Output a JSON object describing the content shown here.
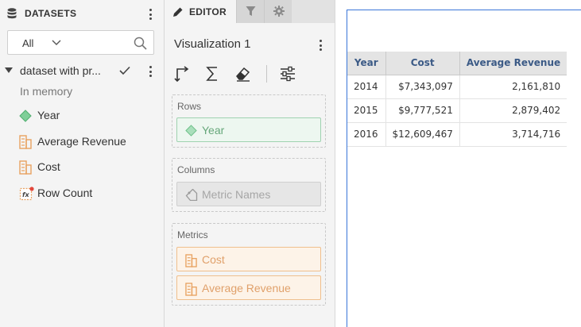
{
  "datasets_panel": {
    "title": "DATASETS",
    "filter": {
      "selected": "All"
    },
    "dataset": {
      "name": "dataset with pr...",
      "status": "In memory"
    },
    "objects": [
      {
        "label": "Year",
        "icon": "attribute-icon"
      },
      {
        "label": "Average Revenue",
        "icon": "metric-icon"
      },
      {
        "label": "Cost",
        "icon": "metric-icon"
      },
      {
        "label": "Row Count",
        "icon": "derived-metric-icon"
      }
    ]
  },
  "editor_panel": {
    "tabs": {
      "editor": "EDITOR",
      "filter_icon": "filter-icon",
      "settings_icon": "gear-icon"
    },
    "visualization_title": "Visualization 1",
    "toolbar": [
      "swap-axes-icon",
      "sum-icon",
      "eraser-icon",
      "settings-sliders-icon"
    ],
    "zones": {
      "rows": {
        "label": "Rows",
        "items": [
          "Year"
        ]
      },
      "columns": {
        "label": "Columns",
        "items": [
          "Metric Names"
        ]
      },
      "metrics": {
        "label": "Metrics",
        "items": [
          "Cost",
          "Average Revenue"
        ]
      }
    }
  },
  "grid": {
    "headers": [
      "Year",
      "Cost",
      "Average Revenue"
    ],
    "rows": [
      [
        "2014",
        "$7,343,097",
        "2,161,810"
      ],
      [
        "2015",
        "$9,777,521",
        "2,879,402"
      ],
      [
        "2016",
        "$12,609,467",
        "3,714,716"
      ]
    ]
  },
  "colors": {
    "attribute": "#5dbb7e",
    "metric": "#e8a15f",
    "header_text": "#3b5a86",
    "selection_border": "#3a76d8"
  }
}
